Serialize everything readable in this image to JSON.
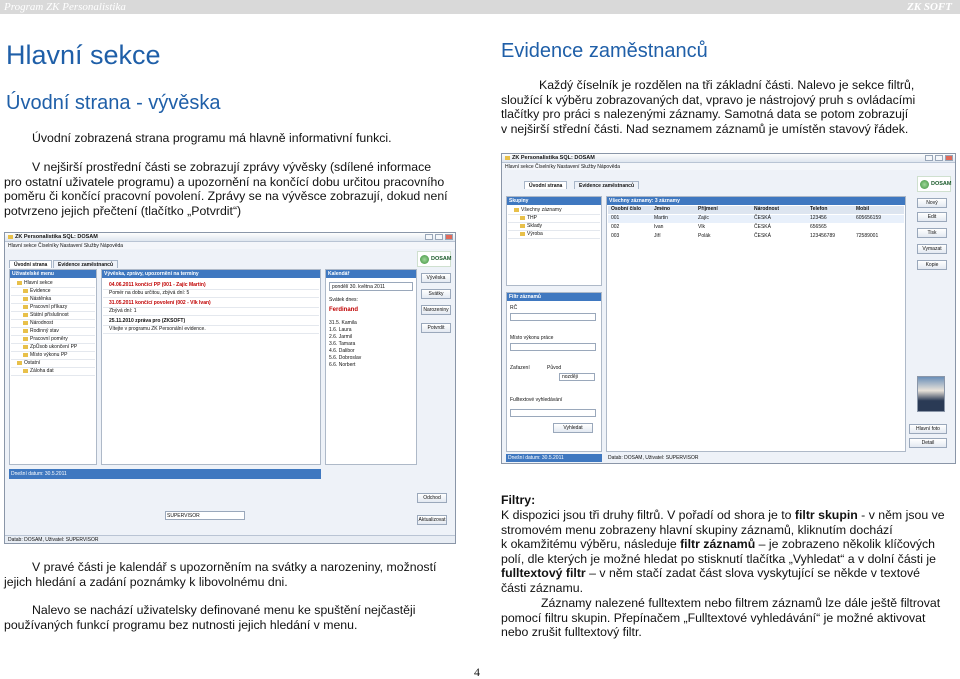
{
  "header": {
    "left": "Program ZK Personalistika",
    "right": "ZK SOFT"
  },
  "left": {
    "title": "Hlavní sekce",
    "subtitle": "Úvodní strana - vývěska",
    "p1": "Úvodní zobrazená strana programu má hlavně informativní funkci.",
    "p2": [
      "V nejširší prostřední části se zobrazují zprávy vývěsky (sdílené informace",
      "pro ostatní uživatele programu) a upozornění na končící dobu určitou pracovního",
      "poměru či končící pracovní povolení. Zprávy se na vývěsce zobrazují, dokud není",
      "potvrzeno jejich přečtení (tlačítko „Potvrdit“)"
    ],
    "p3": [
      "V pravé části je kalendář s upozorněním na svátky a narozeniny, možností",
      "jejich hledání a zadání poznámky k libovolnému dni."
    ],
    "p4": [
      "Nalevo se nachází uživatelsky definované menu ke spuštění nejčastěji",
      "používaných funkcí programu bez nutnosti jejich hledání v menu."
    ]
  },
  "right": {
    "title": "Evidence zaměstnanců",
    "p1": [
      "Každý číselník je rozdělen na tři základní části. Nalevo je sekce filtrů,",
      "sloužící k výběru zobrazovaných dat, vpravo je nástrojový pruh s ovládacími",
      "tlačítky pro práci s nalezenými záznamy. Samotná data se potom zobrazují",
      "v nejširší střední části. Nad seznamem záznamů je umístěn stavový řádek."
    ],
    "filtry_heading": "Filtry:",
    "p2": [
      "K dispozici jsou tři druhy filtrů. V pořadí od shora je to ",
      "filtr skupin",
      " - v něm jsou ve",
      "stromovém menu zobrazeny hlavní skupiny záznamů, kliknutím dochází",
      "k okamžitému výběru, následuje ",
      "filtr záznamů",
      " – je zobrazeno několik klíčových",
      "polí, dle kterých je možné hledat po stisknutí tlačítka „Vyhledat“ a v dolní části je",
      "fulltextový filtr",
      " – v něm stačí zadat část slova vyskytující se někde v textové",
      "části záznamu."
    ],
    "p3": [
      "Záznamy nalezené fulltextem nebo filtrem záznamů lze dále ještě filtrovat",
      "pomocí filtru skupin. Přepínačem „Fulltextové vyhledávání“ je možné aktivovat",
      "nebo zrušit fulltextový filtr."
    ]
  },
  "page_number": "4",
  "shot1": {
    "title": "ZK Personalistika SQL: DOSAM",
    "menu": "Hlavní sekce   Číselníky   Nastavení   Služby   Nápověda",
    "tabs": [
      "Úvodní strana",
      "Evidence zaměstnanců"
    ],
    "user_menu_title": "Uživatelské menu",
    "user_menu_items": [
      "Hlavní sekce",
      "Evidence",
      "Nástěnka",
      "Pracovní příkazy",
      "Státní příslušnost",
      "Národnost",
      "Rodinný stav",
      "Pracovní poměry",
      "ZpŮsob ukončení PP",
      "Místo výkonu PP",
      "Ostatní",
      "Záloha dat"
    ],
    "notice_title": "Vývěska, zprávy, upozornění na termíny",
    "notices": [
      "04.06.2011 končící PP (001 - Zajíc Martin)",
      "Pomér na dobu určitou, zbývá dní: 5",
      "31.05.2011 končící povolení (002 - Vlk Ivan)",
      "Zbývá dní: 1",
      "25.11.2010 zpráva pro (ZKSOFT)",
      "Vítejte v programu ZK Personální evidence."
    ],
    "calendar_title": "Kalendář",
    "date": "pondělí 30. května 2011",
    "svatek_label": "Svátek dnes:",
    "svatek": "Ferdinand",
    "names": [
      "Kamila",
      "Laura",
      "Jarmil",
      "Tamara",
      "Dalibor",
      "Dobroslav",
      "Norbert"
    ],
    "days": [
      "31.5.",
      "1.6.",
      "2.6.",
      "3.6.",
      "4.6.",
      "5.6.",
      "6.6."
    ],
    "buttons": [
      "Vývěska",
      "Svátky",
      "Narozeniny",
      "Potvrdit"
    ],
    "status": "Datab: DOSAM, Uživatel: SUPERVISOR",
    "date_status": "Dnešní datum: 30.5.2011",
    "user_label": "SUPERVISOR",
    "bottom_buttons": [
      "Odchod",
      "Aktualizovat"
    ]
  },
  "shot2": {
    "title": "ZK Personalistika SQL: DOSAM",
    "menu": "Hlavní sekce   Číselníky   Nastavení   Služby   Nápověda",
    "tabs": [
      "Úvodní strana",
      "Evidence zaměstnanců"
    ],
    "groups_title": "Skupiny",
    "groups": [
      "Všechny záznamy",
      "THP",
      "Sklady",
      "Výroba"
    ],
    "records_title": "Všechny záznamy: 3 záznamy",
    "cols": [
      "Osobní číslo",
      "Jméno",
      "Příjmení",
      "Národnost",
      "Telefon",
      "Mobil"
    ],
    "rows": [
      [
        "001",
        "Martin",
        "Zajíc",
        "ČESKÁ",
        "123456",
        "605656159"
      ],
      [
        "002",
        "Ivan",
        "Vlk",
        "ČESKÁ",
        "656565",
        ""
      ],
      [
        "003",
        "Jiří",
        "Polák",
        "ČESKÁ",
        "123456789",
        "72589001"
      ]
    ],
    "filter_title": "Filtr záznamů",
    "filter_fields": [
      "RČ",
      "Místo výkonu práce",
      "Zařazení",
      "Původ",
      "nozději"
    ],
    "fulltext_title": "Fulltextové vyhledávání",
    "search_btn": "Vyhledat",
    "toolbar": [
      "Nový",
      "Edit",
      "Tisk",
      "Vymazat",
      "Kopie"
    ],
    "status": "Datab: DOSAM, Uživatel: SUPERVISOR",
    "date_status": "Dnešní datum: 30.5.2011",
    "photo_label": "Hlavní foto",
    "detail_btn": "Detail"
  }
}
